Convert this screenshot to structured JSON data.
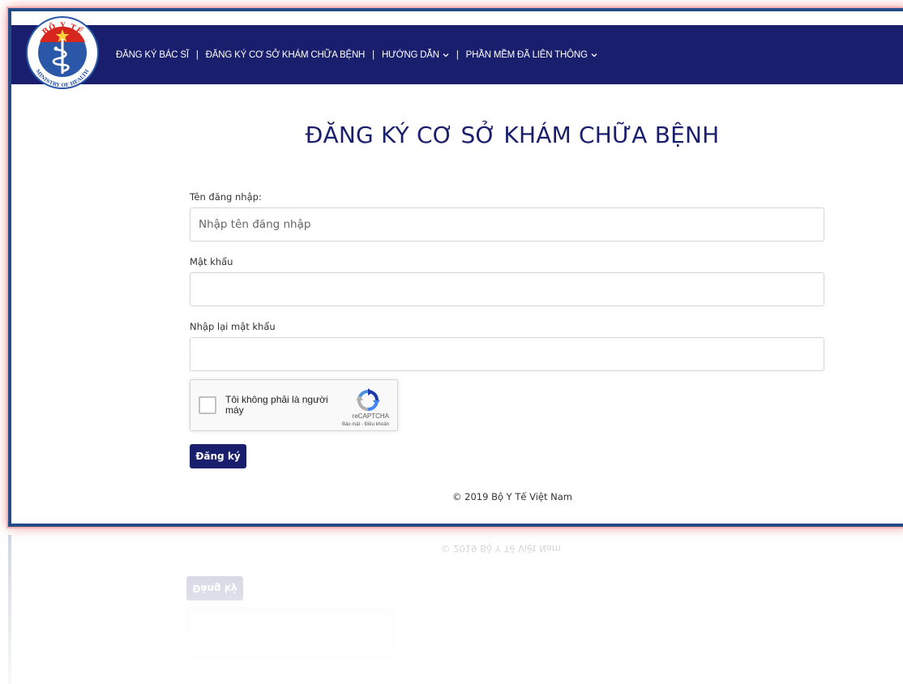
{
  "site": {
    "logo_name": "Bộ Y Tế - Ministry of Health",
    "logo_text_top": "BỘ Y TẾ",
    "logo_text_bottom": "MINISTRY OF HEALTH"
  },
  "nav": {
    "items": [
      {
        "label": "ĐĂNG KÝ BÁC SĨ",
        "has_dropdown": false
      },
      {
        "label": "ĐĂNG KÝ CƠ SỞ KHÁM CHỮA BỆNH",
        "has_dropdown": false
      },
      {
        "label": "HƯỚNG DẪN",
        "has_dropdown": true
      },
      {
        "label": "PHẦN MỀM ĐÃ LIÊN THÔNG",
        "has_dropdown": true
      }
    ],
    "separator": "|"
  },
  "page": {
    "title": "ĐĂNG KÝ CƠ SỞ KHÁM CHỮA BỆNH"
  },
  "form": {
    "username_label": "Tên đăng nhập:",
    "username_placeholder": "Nhập tên đăng nhập",
    "username_value": "",
    "password_label": "Mật khẩu",
    "password_value": "",
    "confirm_label": "Nhập lại mật khẩu",
    "confirm_value": "",
    "submit_label": "Đăng ký"
  },
  "captcha": {
    "label": "Tôi không phải là người máy",
    "brand": "reCAPTCHA",
    "terms": "Bảo mật - Điều khoản",
    "checked": false
  },
  "footer": {
    "copyright": "© 2019 Bộ Y Tế Việt Nam"
  },
  "colors": {
    "primary": "#1a1f6d",
    "frame_border": "#234b86",
    "glow": "#e03a3a",
    "logo_red": "#d7261e",
    "logo_blue": "#2a57a8",
    "star": "#ffd43b"
  }
}
